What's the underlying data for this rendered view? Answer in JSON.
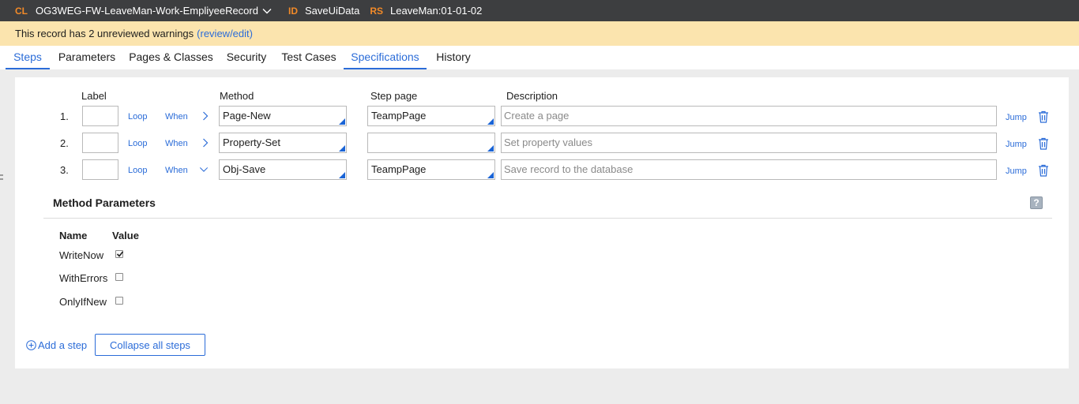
{
  "header": {
    "cl_tag": "CL",
    "class_name": "OG3WEG-FW-LeaveMan-Work-EmpliyeeRecord",
    "id_tag": "ID",
    "record_id": "SaveUiData",
    "rs_tag": "RS",
    "ruleset": "LeaveMan:01-01-02",
    "dropdown_icon": "chevron-down-icon"
  },
  "warning": {
    "text": "This record has 2 unreviewed warnings",
    "link": "(review/edit)"
  },
  "tabs": [
    {
      "label": "Steps",
      "active": true
    },
    {
      "label": "Parameters",
      "active": false
    },
    {
      "label": "Pages & Classes",
      "active": false
    },
    {
      "label": "Security",
      "active": false
    },
    {
      "label": "Test Cases",
      "active": false
    },
    {
      "label": "Specifications",
      "active": false
    },
    {
      "label": "History",
      "active": false
    }
  ],
  "columns": {
    "label": "Label",
    "method": "Method",
    "step_page": "Step page",
    "description": "Description"
  },
  "steps": [
    {
      "num": "1.",
      "label": "",
      "loop": "Loop",
      "when": "When",
      "expanded": false,
      "method": "Page-New",
      "step_page": "TeampPage",
      "description_placeholder": "Create a page",
      "jump": "Jump"
    },
    {
      "num": "2.",
      "label": "",
      "loop": "Loop",
      "when": "When",
      "expanded": false,
      "method": "Property-Set",
      "step_page": "",
      "description_placeholder": "Set property values",
      "jump": "Jump"
    },
    {
      "num": "3.",
      "label": "",
      "loop": "Loop",
      "when": "When",
      "expanded": true,
      "method": "Obj-Save",
      "step_page": "TeampPage",
      "description_placeholder": "Save record to the database",
      "jump": "Jump"
    }
  ],
  "method_parameters": {
    "title": "Method Parameters",
    "help_icon": "help-icon",
    "name_header": "Name",
    "value_header": "Value",
    "params": [
      {
        "name": "WriteNow",
        "checked": true
      },
      {
        "name": "WithErrors",
        "checked": false
      },
      {
        "name": "OnlyIfNew",
        "checked": false
      }
    ]
  },
  "actions": {
    "add_step": "Add a step",
    "collapse_all": "Collapse all steps"
  },
  "colors": {
    "accent": "#2b6cd8",
    "header_bg": "#3d3e40",
    "header_tag": "#f28a28",
    "warning_bg": "#fbe4ae"
  }
}
